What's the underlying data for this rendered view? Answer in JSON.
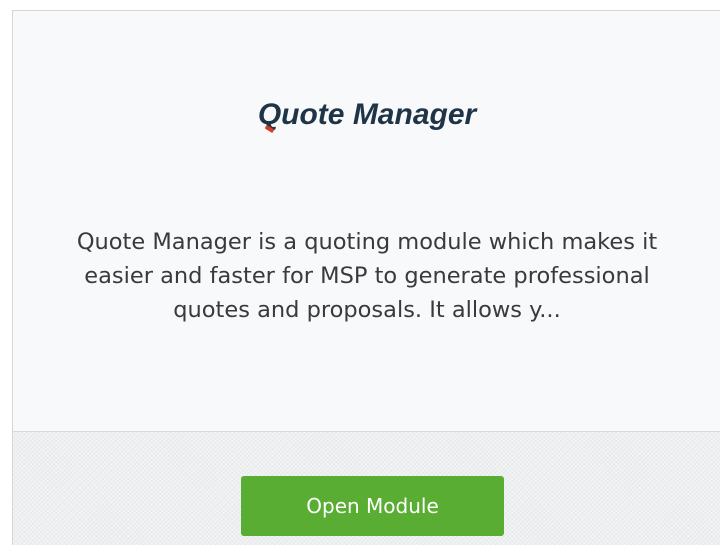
{
  "card": {
    "logo_text_first": "Q",
    "logo_text_rest": "uote Manager",
    "description": "Quote Manager is a quoting module which makes it easier and faster for MSP to generate professional quotes and proposals. It allows y...",
    "button_label": "Open Module"
  },
  "colors": {
    "logo_text": "#1f3447",
    "logo_accent": "#d63a2a",
    "button_bg": "#58ad32",
    "button_text": "#ffffff"
  }
}
